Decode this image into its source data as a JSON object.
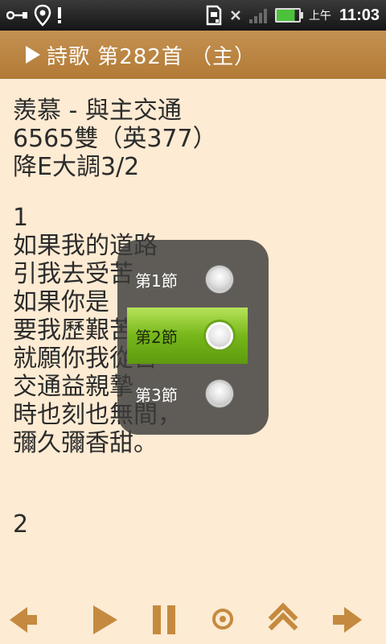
{
  "status_bar": {
    "time": "11:03",
    "ampm": "上午",
    "left_icons": [
      "usb-icon",
      "location-icon",
      "alert-icon"
    ],
    "right_icons": [
      "sd-card-icon",
      "no-signal-icon",
      "signal-bars-icon",
      "battery-charging-icon"
    ],
    "battery_color": "#4cc13b"
  },
  "title_bar": {
    "icon": "play-icon",
    "title": "詩歌 第282首 （主）",
    "bg_color": "#b98240"
  },
  "hymn": {
    "name": "羨慕 - 與主交通",
    "number": "6565雙（英377）",
    "key": "降E大調3/2",
    "verse1_number": "1",
    "verse1_lines": [
      "如果我的道路",
      "引我去受苦，",
      "如果你是",
      "要我歷艱苦，",
      "就願你我從苦",
      "交通益親摯，",
      "時也刻也無間，",
      "彌久彌香甜。"
    ],
    "verse2_number": "2"
  },
  "verse_popup": {
    "options": [
      {
        "label": "第1節",
        "selected": false
      },
      {
        "label": "第2節",
        "selected": true
      },
      {
        "label": "第3節",
        "selected": false
      }
    ],
    "selected_color": "#76b71a"
  },
  "toolbar": {
    "buttons": [
      "previous-arrow-icon",
      "play-icon",
      "pause-icon",
      "stop-icon",
      "scroll-up-icon",
      "next-arrow-icon"
    ],
    "icon_color": "#c58a3f"
  }
}
